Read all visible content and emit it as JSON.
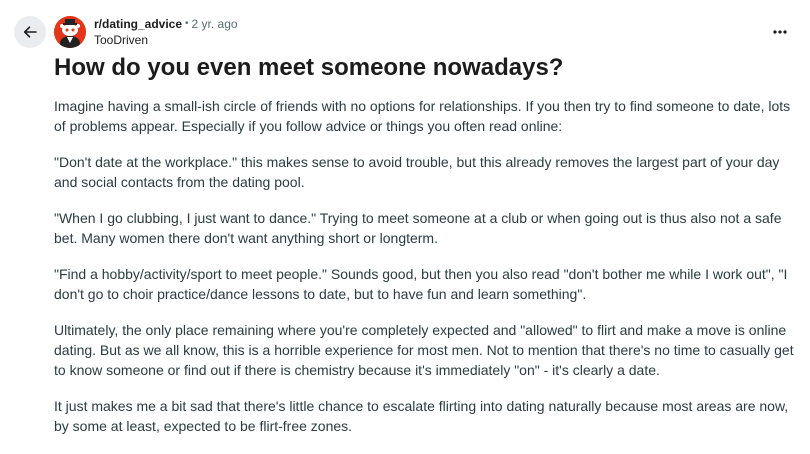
{
  "post": {
    "subreddit": "r/dating_advice",
    "separator": "•",
    "time_ago": "2 yr. ago",
    "author": "TooDriven",
    "title": "How do you even meet someone nowadays?",
    "paragraphs": [
      "Imagine having a small-ish circle of friends with no options for relationships. If you then try to find someone to date, lots of problems appear. Especially if you follow advice or things you often read online:",
      "\"Don't date at the workplace.\" this makes sense to avoid trouble, but this already removes the largest part of your day and social contacts from the dating pool.",
      "\"When I go clubbing, I just want to dance.\" Trying to meet someone at a club or when going out is thus also not a safe bet. Many women there don't want anything short or longterm.",
      "\"Find a hobby/activity/sport to meet people.\" Sounds good, but then you also read \"don't bother me while I work out\", \"I don't go to choir practice/dance lessons to date, but to have fun and learn something\".",
      "Ultimately, the only place remaining where you're completely expected and \"allowed\" to flirt and make a move is online dating. But as we all know, this is a horrible experience for most men. Not to mention that there's no time to casually get to know someone or find out if there is chemistry because it's immediately \"on\" - it's clearly a date.",
      "It just makes me a bit sad that there's little chance to escalate flirting into dating naturally because most areas are now, by some at least, expected to be flirt-free zones."
    ]
  },
  "icons": {
    "back": "arrow-left-icon",
    "more": "more-horizontal-icon",
    "avatar": "subreddit-avatar"
  },
  "colors": {
    "accent": "#ff4500",
    "button_bg": "#eaedef",
    "meta_text": "#576f76",
    "body_text": "#2a3c42"
  }
}
